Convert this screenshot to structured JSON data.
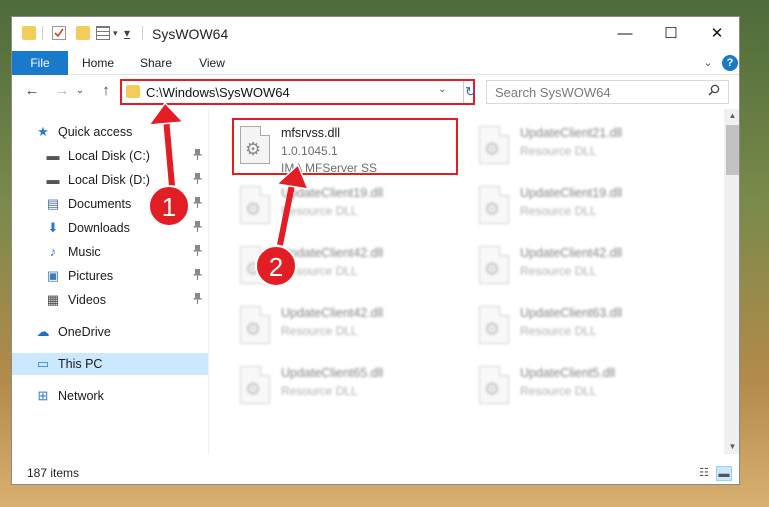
{
  "window": {
    "title": "SysWOW64",
    "qa_dropdown": "▾",
    "minimize": "—",
    "maximize": "☐",
    "close": "✕"
  },
  "ribbon": {
    "tabs": [
      "File",
      "Home",
      "Share",
      "View"
    ],
    "expand": "⌄",
    "help": "?"
  },
  "nav": {
    "back": "←",
    "forward": "→",
    "recent": "⌄",
    "up": "↑"
  },
  "address": {
    "path": "C:\\Windows\\SysWOW64",
    "dropdown": "⌄",
    "refresh": "↻"
  },
  "search": {
    "placeholder": "Search SysWOW64"
  },
  "sidebar": {
    "items": [
      {
        "label": "Quick access",
        "icon": "star-icon",
        "glyph": "★",
        "color": "#2a7ad5",
        "pinned": false
      },
      {
        "label": "Local Disk (C:)",
        "icon": "drive-icon",
        "glyph": "▬",
        "color": "#555555",
        "pinned": true
      },
      {
        "label": "Local Disk (D:)",
        "icon": "drive-icon",
        "glyph": "▬",
        "color": "#555555",
        "pinned": true
      },
      {
        "label": "Documents",
        "icon": "documents-icon",
        "glyph": "▤",
        "color": "#4a6ea9",
        "pinned": true
      },
      {
        "label": "Downloads",
        "icon": "download-arrow-icon",
        "glyph": "⬇",
        "color": "#2a7ad5",
        "pinned": true
      },
      {
        "label": "Music",
        "icon": "music-note-icon",
        "glyph": "♪",
        "color": "#2a7ad5",
        "pinned": true
      },
      {
        "label": "Pictures",
        "icon": "pictures-icon",
        "glyph": "▣",
        "color": "#3d7bb5",
        "pinned": true
      },
      {
        "label": "Videos",
        "icon": "film-icon",
        "glyph": "▦",
        "color": "#444444",
        "pinned": true
      },
      {
        "label": "OneDrive",
        "icon": "cloud-icon",
        "glyph": "☁",
        "color": "#1a6fc9",
        "pinned": false
      },
      {
        "label": "This PC",
        "icon": "computer-icon",
        "glyph": "▭",
        "color": "#2a7ad5",
        "pinned": false
      },
      {
        "label": "Network",
        "icon": "network-icon",
        "glyph": "⊞",
        "color": "#2a7ad5",
        "pinned": false
      }
    ],
    "pin_glyph": "📌"
  },
  "files": [
    {
      "name": "mfsrvss.dll",
      "line1": "1.0.1045.1",
      "line2": "IMA MFServer SS"
    },
    {
      "name": "UpdateClient21.dll",
      "line1": "Resource DLL",
      "line2": ""
    },
    {
      "name": "UpdateClient19.dll",
      "line1": "Resource DLL",
      "line2": ""
    },
    {
      "name": "UpdateClient19.dll",
      "line1": "Resource DLL",
      "line2": ""
    },
    {
      "name": "UpdateClient42.dll",
      "line1": "Resource DLL",
      "line2": ""
    },
    {
      "name": "UpdateClient42.dll",
      "line1": "Resource DLL",
      "line2": ""
    },
    {
      "name": "UpdateClient42.dll",
      "line1": "Resource DLL",
      "line2": ""
    },
    {
      "name": "UpdateClient63.dll",
      "line1": "Resource DLL",
      "line2": ""
    },
    {
      "name": "UpdateClient65.dll",
      "line1": "Resource DLL",
      "line2": ""
    },
    {
      "name": "UpdateClient5.dll",
      "line1": "Resource DLL",
      "line2": ""
    }
  ],
  "status": {
    "item_count": "187 items"
  },
  "annotations": {
    "badge1": "1",
    "badge2": "2",
    "color": "#e21d24"
  }
}
